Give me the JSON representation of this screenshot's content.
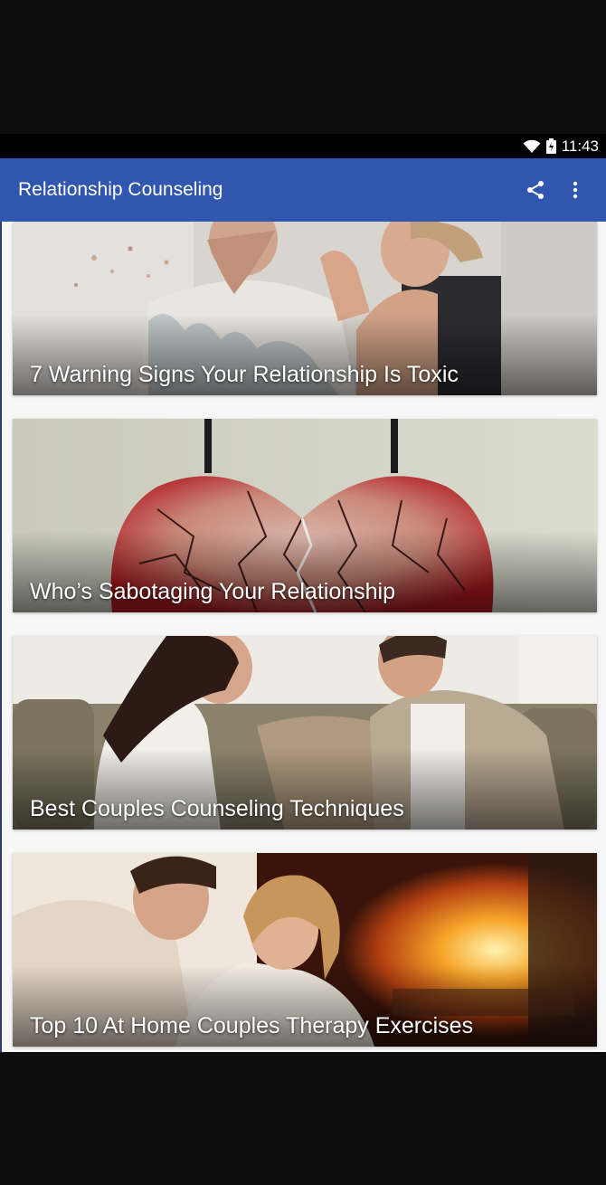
{
  "status_bar": {
    "time": "11:43",
    "icons": [
      "wifi-icon",
      "battery-icon"
    ]
  },
  "app_bar": {
    "title": "Relationship Counseling",
    "actions": [
      "share-icon",
      "overflow-menu-icon"
    ]
  },
  "colors": {
    "app_bar": "#3056b0",
    "background": "#f7f7f7"
  },
  "articles": [
    {
      "title": "7 Warning Signs Your Relationship Is Toxic",
      "image": "arguing-couple-image"
    },
    {
      "title": "Who’s Sabotaging Your Relationship",
      "image": "broken-heart-image"
    },
    {
      "title": "Best Couples Counseling Techniques",
      "image": "couple-on-sofa-image"
    },
    {
      "title": "Top 10 At Home Couples Therapy Exercises",
      "image": "couple-by-fireplace-image"
    }
  ]
}
